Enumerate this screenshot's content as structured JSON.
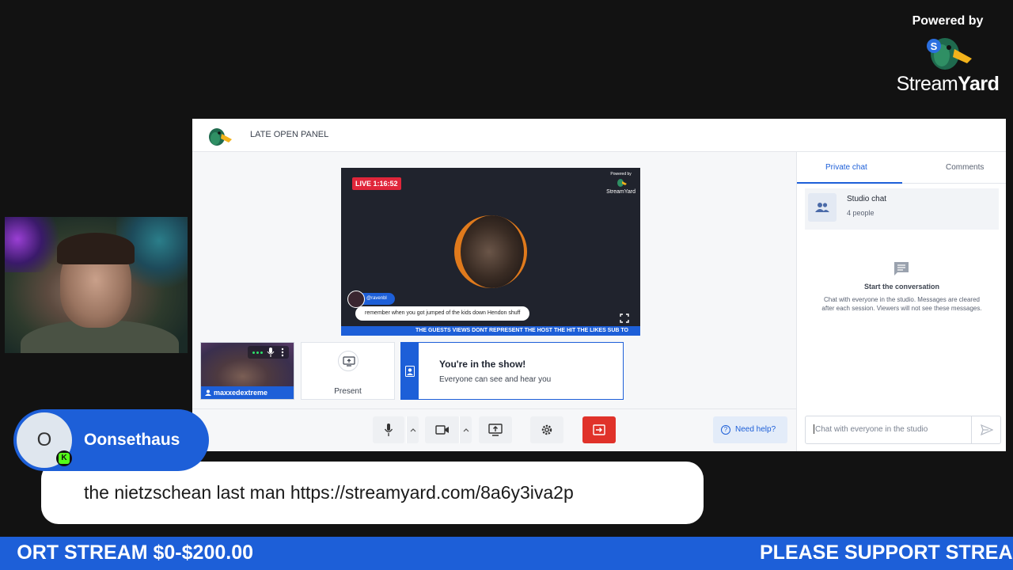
{
  "powered": {
    "label": "Powered by",
    "brand_light": "Stream",
    "brand_bold": "Yard"
  },
  "studio": {
    "title": "LATE OPEN PANEL",
    "preview": {
      "live_badge": "LIVE 1:16:52",
      "mini_powered": "Powered by",
      "mini_brand": "StreamYard",
      "comment_user": "@ravenbl",
      "comment_text": "remember when you got jumped of the kids down Hendon shuff",
      "ticker_text": "THE GUESTS VIEWS DONT REPRESENT THE HOST THE HIT THE LIKES SUB TO"
    },
    "guest_tile": {
      "name": "maxxedextreme"
    },
    "present_tile": {
      "label": "Present"
    },
    "show_card": {
      "title": "You're in the show!",
      "subtitle": "Everyone can see and hear you"
    },
    "toolbar": {
      "help_label": "Need help?"
    },
    "chat": {
      "tabs": [
        "Private chat",
        "Comments"
      ],
      "active_tab": "Private chat",
      "studio_chat_title": "Studio chat",
      "studio_chat_sub": "4 people",
      "empty_title": "Start the conversation",
      "empty_text": "Chat with everyone in the studio. Messages are cleared after each session. Viewers will not see these messages.",
      "input_placeholder": "Chat with everyone in the studio"
    }
  },
  "overlay_comment": {
    "avatar_letter": "O",
    "badge": "K",
    "username": "Oonsethaus",
    "message": "the nietzschean last man https://streamyard.com/8a6y3iva2p"
  },
  "banner": {
    "left_text": "ORT STREAM $0-$200.00",
    "right_text": "PLEASE SUPPORT STREAM"
  },
  "colors": {
    "accent_blue": "#1d5fd8",
    "live_red": "#e0263a",
    "leave_red": "#e0322a",
    "kick_green": "#53fc18",
    "background": "#121212"
  },
  "icons": [
    "duck-logo-icon",
    "mic-icon",
    "camera-icon",
    "screen-share-icon",
    "gear-icon",
    "leave-icon",
    "help-icon",
    "people-icon",
    "chat-icon",
    "send-icon",
    "fullscreen-icon",
    "person-icon",
    "more-vertical-icon",
    "chevron-up-icon"
  ]
}
